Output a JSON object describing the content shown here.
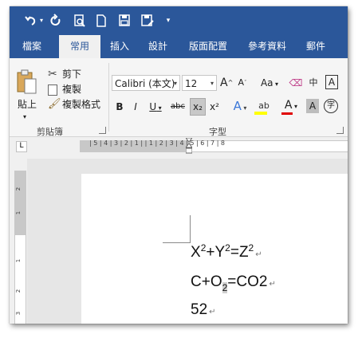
{
  "qat": {
    "undo_icon": "undo-icon",
    "redo_icon": "redo-icon",
    "print_preview_icon": "print-preview-icon",
    "new_icon": "new-document-icon",
    "save_icon": "save-icon",
    "save_as_icon": "save-as-icon",
    "more_icon": "customize-qat-icon",
    "more_label": "▾"
  },
  "tabs": [
    "檔案",
    "常用",
    "插入",
    "設計",
    "版面配置",
    "參考資料",
    "郵件"
  ],
  "active_tab": "常用",
  "clipboard": {
    "paste_label": "貼上",
    "cut_label": "剪下",
    "copy_label": "複製",
    "format_painter_label": "複製格式",
    "group_label": "剪貼簿"
  },
  "font": {
    "font_name": "Calibri (本文)",
    "font_size": "12",
    "grow_label": "A",
    "shrink_label": "A",
    "case_label": "Aa",
    "bold_label": "B",
    "italic_label": "I",
    "underline_label": "U",
    "strike_label": "abc",
    "subscript_label": "x₂",
    "superscript_label": "x²",
    "effects_label": "A",
    "highlight_label": "ab",
    "font_color_label": "A",
    "shade_label": "A",
    "enclose_label": "字",
    "phonetic_label": "中",
    "border_label": "A",
    "group_label": "字型"
  },
  "ruler": {
    "tab_selector": "L",
    "text": "| 5 | 4 | 3 | 2 | 1 |     | 1 | 2 | 3 | 4 | 5 | 6 | 7 | 8"
  },
  "vruler_numbers": [
    "2",
    "1",
    "1",
    "2",
    "3"
  ],
  "document": {
    "line1": {
      "x": "X",
      "x_sup": "2",
      "plus": "+Y",
      "y_sup": "2",
      "eq": "=Z",
      "z_sup": "2"
    },
    "line2": {
      "pre": "C+O",
      "sub": "2",
      "post": "=CO2"
    },
    "line3": "52",
    "pilcrow": "↵"
  },
  "colors": {
    "title_bar": "#2b579a",
    "ribbon_bg": "#f5f5f5",
    "doc_bg": "#e6e6e6",
    "highlight_yellow": "#ffff00",
    "font_color_red": "#e00000"
  }
}
